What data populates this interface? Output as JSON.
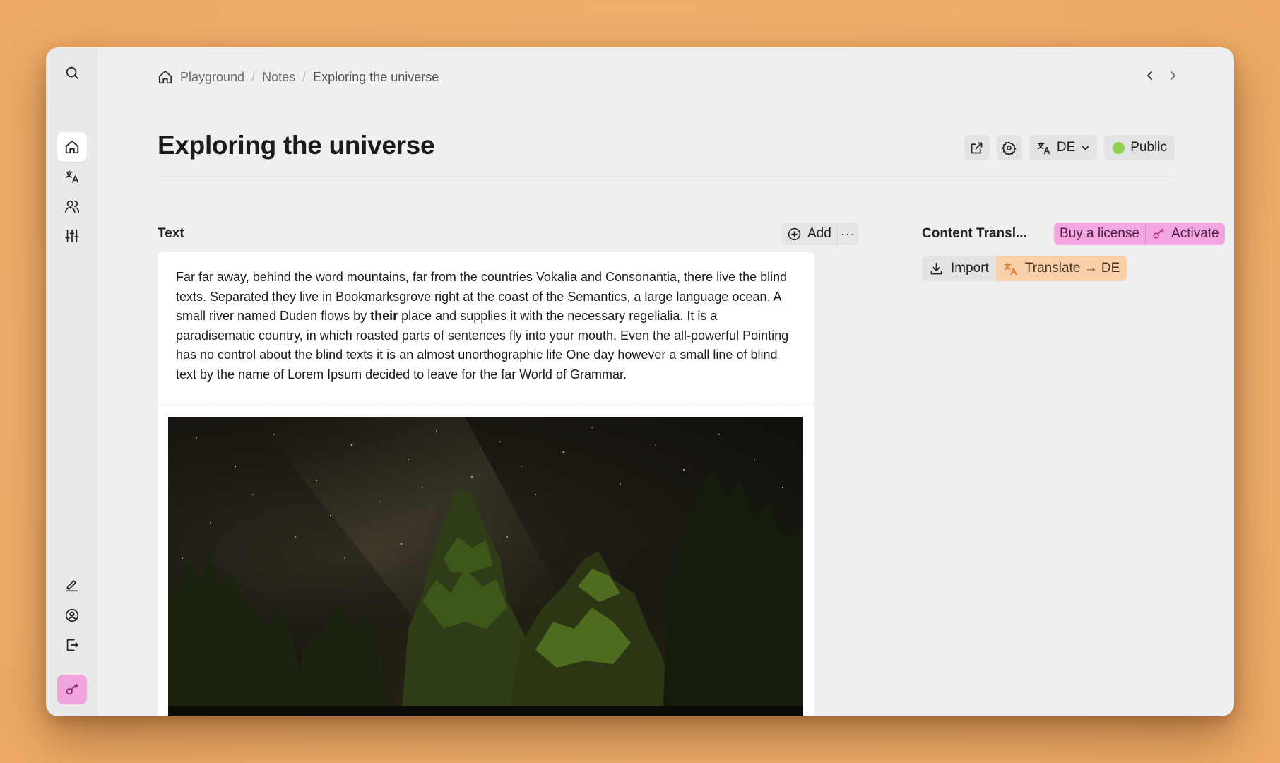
{
  "breadcrumb": {
    "items": [
      "Playground",
      "Notes",
      "Exploring the universe"
    ],
    "separator": "/"
  },
  "page": {
    "title": "Exploring the universe"
  },
  "title_actions": {
    "language_code": "DE",
    "visibility_label": "Public",
    "visibility_color": "#8fd14f"
  },
  "text_block": {
    "label": "Text",
    "add_label": "Add",
    "more_label": "···",
    "content_before": "Far far away, behind the word mountains, far from the countries Vokalia and Consonantia, there live the blind texts. Separated they live in Bookmarksgrove right at the coast of the Semantics, a large language ocean. A small river named Duden flows by ",
    "content_bold": "their",
    "content_after": " place and supplies it with the necessary regelialia. It is a paradisematic country, in which roasted parts of sentences fly into your mouth. Even the all-powerful Pointing has no control about the blind texts it is an almost unorthographic life One day however a small line of blind text by the name of Lorem Ipsum decided to leave for the far World of Grammar."
  },
  "content_translation": {
    "label": "Content Transl...",
    "buy_license_label": "Buy a license",
    "activate_label": "Activate",
    "import_label": "Import",
    "translate_label": "Translate → DE",
    "license_color": "#f3a6df",
    "translate_color": "#f8d0a9"
  },
  "sidebar": {
    "top_icons": [
      "search-icon"
    ],
    "nav_icons": [
      "home-icon",
      "translate-icon",
      "users-icon",
      "sliders-icon"
    ],
    "bottom_icons": [
      "edit-icon",
      "account-icon",
      "logout-icon",
      "key-icon"
    ],
    "active": "home-icon",
    "key_color": "#f1a3dd"
  },
  "colors": {
    "background": "#f0b06e",
    "window": "#efefef"
  }
}
